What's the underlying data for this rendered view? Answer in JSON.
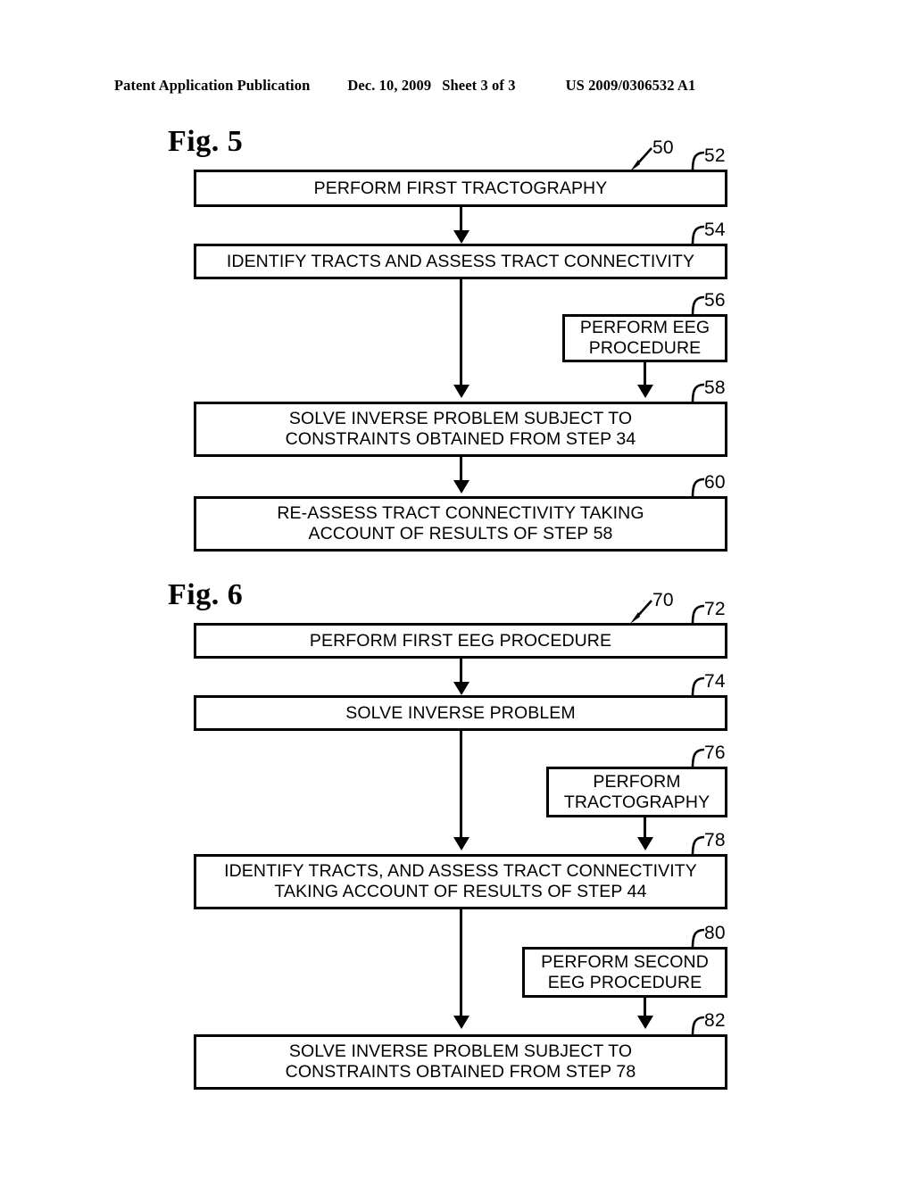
{
  "header": {
    "publication": "Patent Application Publication",
    "date": "Dec. 10, 2009",
    "sheet": "Sheet 3 of 3",
    "patent_number": "US 2009/0306532 A1"
  },
  "figures": [
    {
      "label": "Fig. 5",
      "overall_ref": "50",
      "boxes": [
        {
          "ref": "52",
          "text": "PERFORM FIRST TRACTOGRAPHY"
        },
        {
          "ref": "54",
          "text": "IDENTIFY TRACTS AND ASSESS TRACT CONNECTIVITY"
        },
        {
          "ref": "56",
          "text": "PERFORM EEG\nPROCEDURE"
        },
        {
          "ref": "58",
          "text": "SOLVE INVERSE PROBLEM SUBJECT TO\nCONSTRAINTS OBTAINED FROM STEP 34"
        },
        {
          "ref": "60",
          "text": "RE-ASSESS TRACT CONNECTIVITY TAKING\nACCOUNT OF RESULTS OF STEP 58"
        }
      ]
    },
    {
      "label": "Fig. 6",
      "overall_ref": "70",
      "boxes": [
        {
          "ref": "72",
          "text": "PERFORM FIRST EEG PROCEDURE"
        },
        {
          "ref": "74",
          "text": "SOLVE INVERSE PROBLEM"
        },
        {
          "ref": "76",
          "text": "PERFORM\nTRACTOGRAPHY"
        },
        {
          "ref": "78",
          "text": "IDENTIFY TRACTS, AND ASSESS TRACT CONNECTIVITY\nTAKING ACCOUNT OF RESULTS OF STEP 44"
        },
        {
          "ref": "80",
          "text": "PERFORM SECOND\nEEG PROCEDURE"
        },
        {
          "ref": "82",
          "text": "SOLVE INVERSE PROBLEM SUBJECT TO\nCONSTRAINTS OBTAINED FROM STEP 78"
        }
      ]
    }
  ],
  "colors": {
    "ink": "#000000",
    "paper": "#ffffff"
  }
}
